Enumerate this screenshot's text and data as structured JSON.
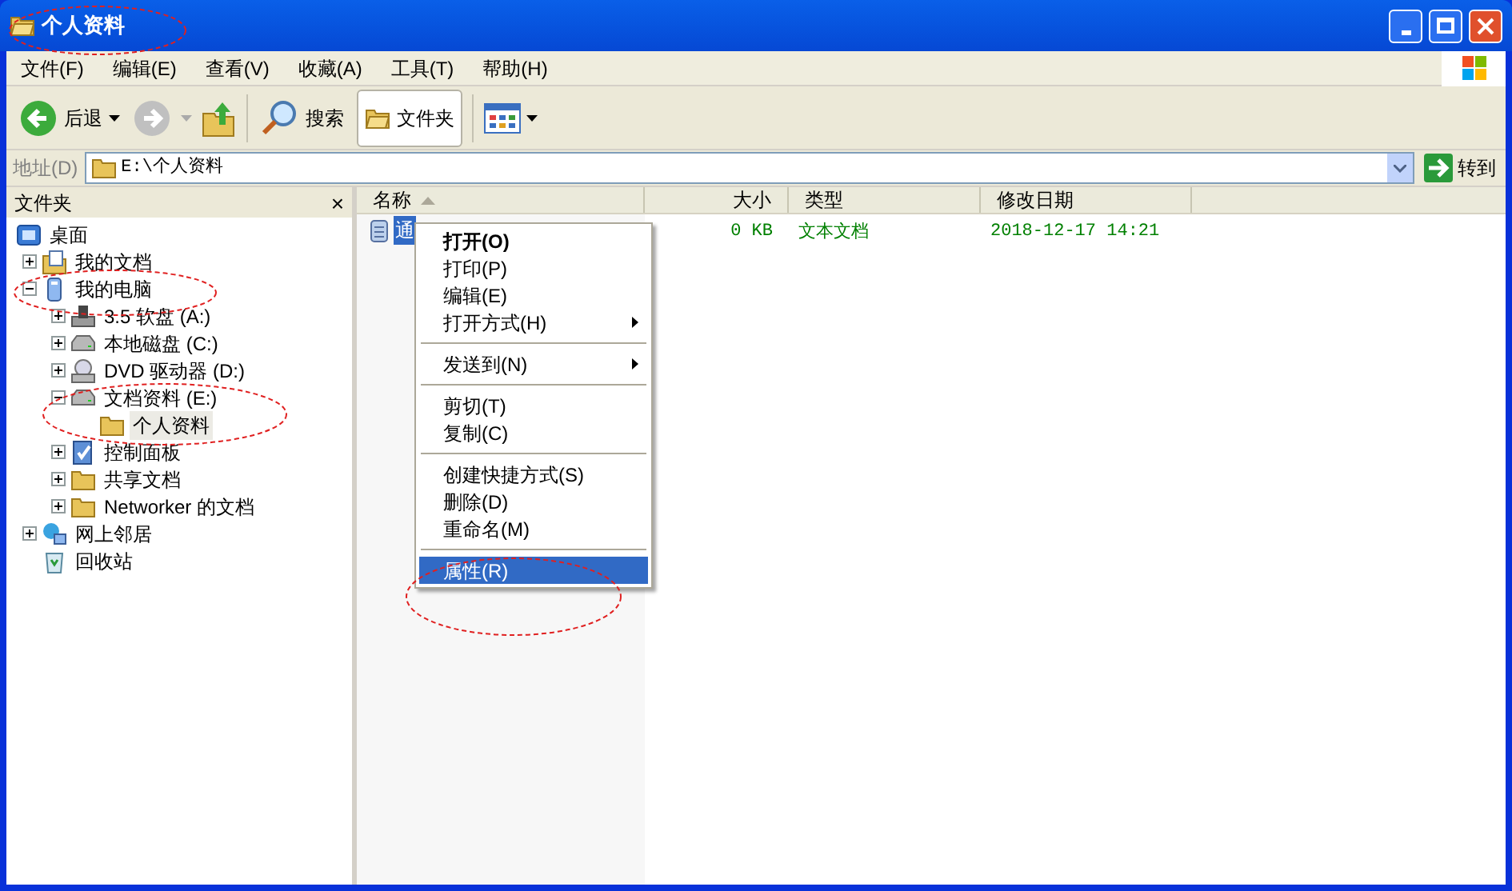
{
  "window": {
    "title": "个人资料"
  },
  "menu_bar": [
    {
      "label": "文件(F)"
    },
    {
      "label": "编辑(E)"
    },
    {
      "label": "查看(V)"
    },
    {
      "label": "收藏(A)"
    },
    {
      "label": "工具(T)"
    },
    {
      "label": "帮助(H)"
    }
  ],
  "toolbar": {
    "back": "后退",
    "search": "搜索",
    "folders": {
      "label": "文件夹",
      "selected": true
    }
  },
  "address_bar": {
    "label": "地址(D)",
    "value": "E:\\个人资料",
    "go": "转到"
  },
  "folders_pane": {
    "title": "文件夹",
    "close": "×",
    "tree": [
      {
        "label": "桌面",
        "kind": "desktop",
        "selected": false,
        "children": [
          {
            "label": "我的文档",
            "kind": "documents",
            "expanded": false,
            "selected": false
          },
          {
            "label": "我的电脑",
            "kind": "computer",
            "expanded": true,
            "selected": false,
            "children": [
              {
                "label": "3.5 软盘 (A:)",
                "kind": "floppy",
                "expanded": false,
                "selected": false
              },
              {
                "label": "本地磁盘 (C:)",
                "kind": "drive",
                "expanded": false,
                "selected": false
              },
              {
                "label": "DVD 驱动器 (D:)",
                "kind": "dvd",
                "expanded": false,
                "selected": false
              },
              {
                "label": "文档资料 (E:)",
                "kind": "drive",
                "expanded": true,
                "selected": false,
                "children": [
                  {
                    "label": "个人资料",
                    "kind": "folder",
                    "selected": true
                  }
                ]
              },
              {
                "label": "控制面板",
                "kind": "control-panel",
                "expanded": false,
                "selected": false
              },
              {
                "label": "共享文档",
                "kind": "folder",
                "expanded": false,
                "selected": false
              },
              {
                "label": "Networker 的文档",
                "kind": "folder",
                "expanded": false,
                "selected": false
              }
            ]
          },
          {
            "label": "网上邻居",
            "kind": "network",
            "expanded": false,
            "selected": false
          },
          {
            "label": "回收站",
            "kind": "recycle-bin",
            "selected": false
          }
        ]
      }
    ]
  },
  "file_list": {
    "columns": [
      {
        "label": "名称",
        "sorted": true
      },
      {
        "label": "大小",
        "sorted": false
      },
      {
        "label": "类型",
        "sorted": false
      },
      {
        "label": "修改日期",
        "sorted": false
      }
    ],
    "rows": [
      {
        "name": "通",
        "size": "0 KB",
        "type": "文本文档",
        "modified": "2018-12-17 14:21",
        "selected": true
      }
    ]
  },
  "context_menu": [
    {
      "kind": "item",
      "label": "打开(O)",
      "default": true,
      "submenu": false,
      "selected": false
    },
    {
      "kind": "item",
      "label": "打印(P)",
      "default": false,
      "submenu": false,
      "selected": false
    },
    {
      "kind": "item",
      "label": "编辑(E)",
      "default": false,
      "submenu": false,
      "selected": false
    },
    {
      "kind": "item",
      "label": "打开方式(H)",
      "default": false,
      "submenu": true,
      "selected": false
    },
    {
      "kind": "separator"
    },
    {
      "kind": "item",
      "label": "发送到(N)",
      "default": false,
      "submenu": true,
      "selected": false
    },
    {
      "kind": "separator"
    },
    {
      "kind": "item",
      "label": "剪切(T)",
      "default": false,
      "submenu": false,
      "selected": false
    },
    {
      "kind": "item",
      "label": "复制(C)",
      "default": false,
      "submenu": false,
      "selected": false
    },
    {
      "kind": "separator"
    },
    {
      "kind": "item",
      "label": "创建快捷方式(S)",
      "default": false,
      "submenu": false,
      "selected": false
    },
    {
      "kind": "item",
      "label": "删除(D)",
      "default": false,
      "submenu": false,
      "selected": false
    },
    {
      "kind": "item",
      "label": "重命名(M)",
      "default": false,
      "submenu": false,
      "selected": false
    },
    {
      "kind": "separator"
    },
    {
      "kind": "item",
      "label": "属性(R)",
      "default": false,
      "submenu": false,
      "selected": true
    }
  ]
}
